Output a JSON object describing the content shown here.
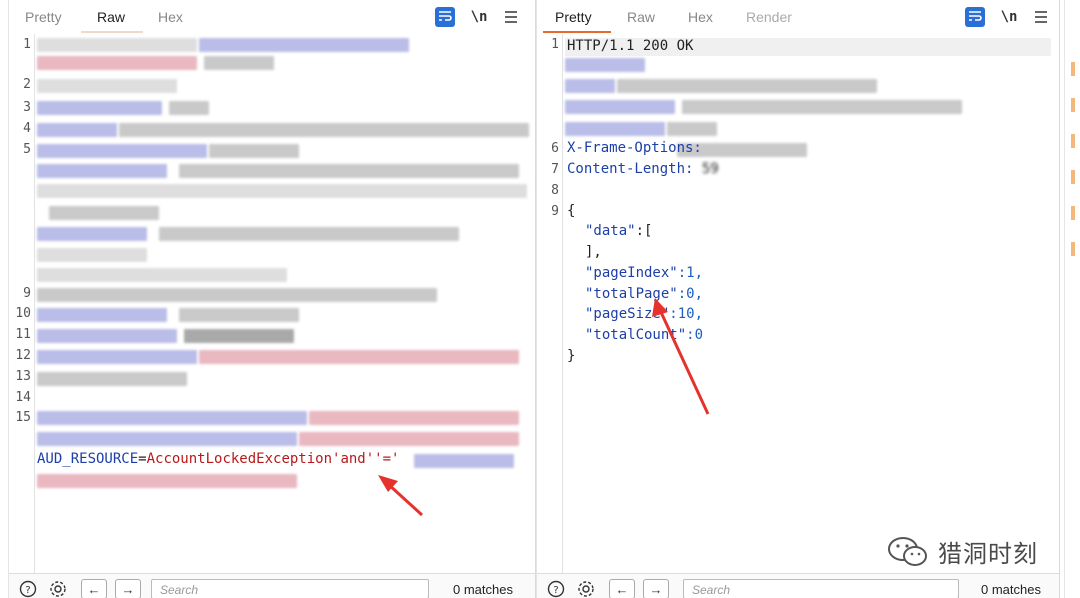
{
  "request": {
    "tabs": [
      {
        "label": "Pretty",
        "active": false
      },
      {
        "label": "Raw",
        "active": true
      },
      {
        "label": "Hex",
        "active": false
      }
    ],
    "toolbar": {
      "wrap_icon": "word-wrap-icon",
      "newline_label": "\\n",
      "menu_icon": "hamburger-menu-icon"
    },
    "line_numbers": [
      "1",
      "2",
      "3",
      "4",
      "5",
      "9",
      "10",
      "11",
      "12",
      "13",
      "14",
      "15"
    ],
    "payload": {
      "param": "AUD_RESOURCE",
      "equals": "=",
      "value": "AccountLockedException'and''='"
    },
    "search_placeholder": "Search",
    "matches": "0 matches"
  },
  "response": {
    "tabs": [
      {
        "label": "Pretty",
        "active": true
      },
      {
        "label": "Raw",
        "active": false
      },
      {
        "label": "Hex",
        "active": false
      },
      {
        "label": "Render",
        "active": false
      }
    ],
    "toolbar": {
      "wrap_icon": "word-wrap-icon",
      "newline_label": "\\n",
      "menu_icon": "hamburger-menu-icon"
    },
    "line_numbers": [
      "1",
      "6",
      "7",
      "8",
      "9"
    ],
    "status_line": "HTTP/1.1 200 OK",
    "header_6": "X-Frame-Options:",
    "header_7_name": "Content-Length:",
    "header_7_value": "59",
    "json": {
      "open": "{",
      "data_key": "\"data\"",
      "data_open": ":[",
      "data_close": "],",
      "pageIndex_key": "\"pageIndex\"",
      "pageIndex_val": ":1,",
      "totalPage_key": "\"totalPage\"",
      "totalPage_val": ":0,",
      "pageSize_key": "\"pageSize\"",
      "pageSize_val": ":10,",
      "totalCount_key": "\"totalCount\"",
      "totalCount_val": ":0",
      "close": "}"
    },
    "search_placeholder": "Search",
    "matches": "0 matches"
  },
  "watermark": {
    "icon": "wechat-icon",
    "text": "猎洞时刻"
  },
  "colors": {
    "accent": "#e46a2e",
    "wrap_button": "#2a6fd6",
    "arrow": "#e5322d",
    "param": "#1c3fa8",
    "string": "#b8191a"
  }
}
